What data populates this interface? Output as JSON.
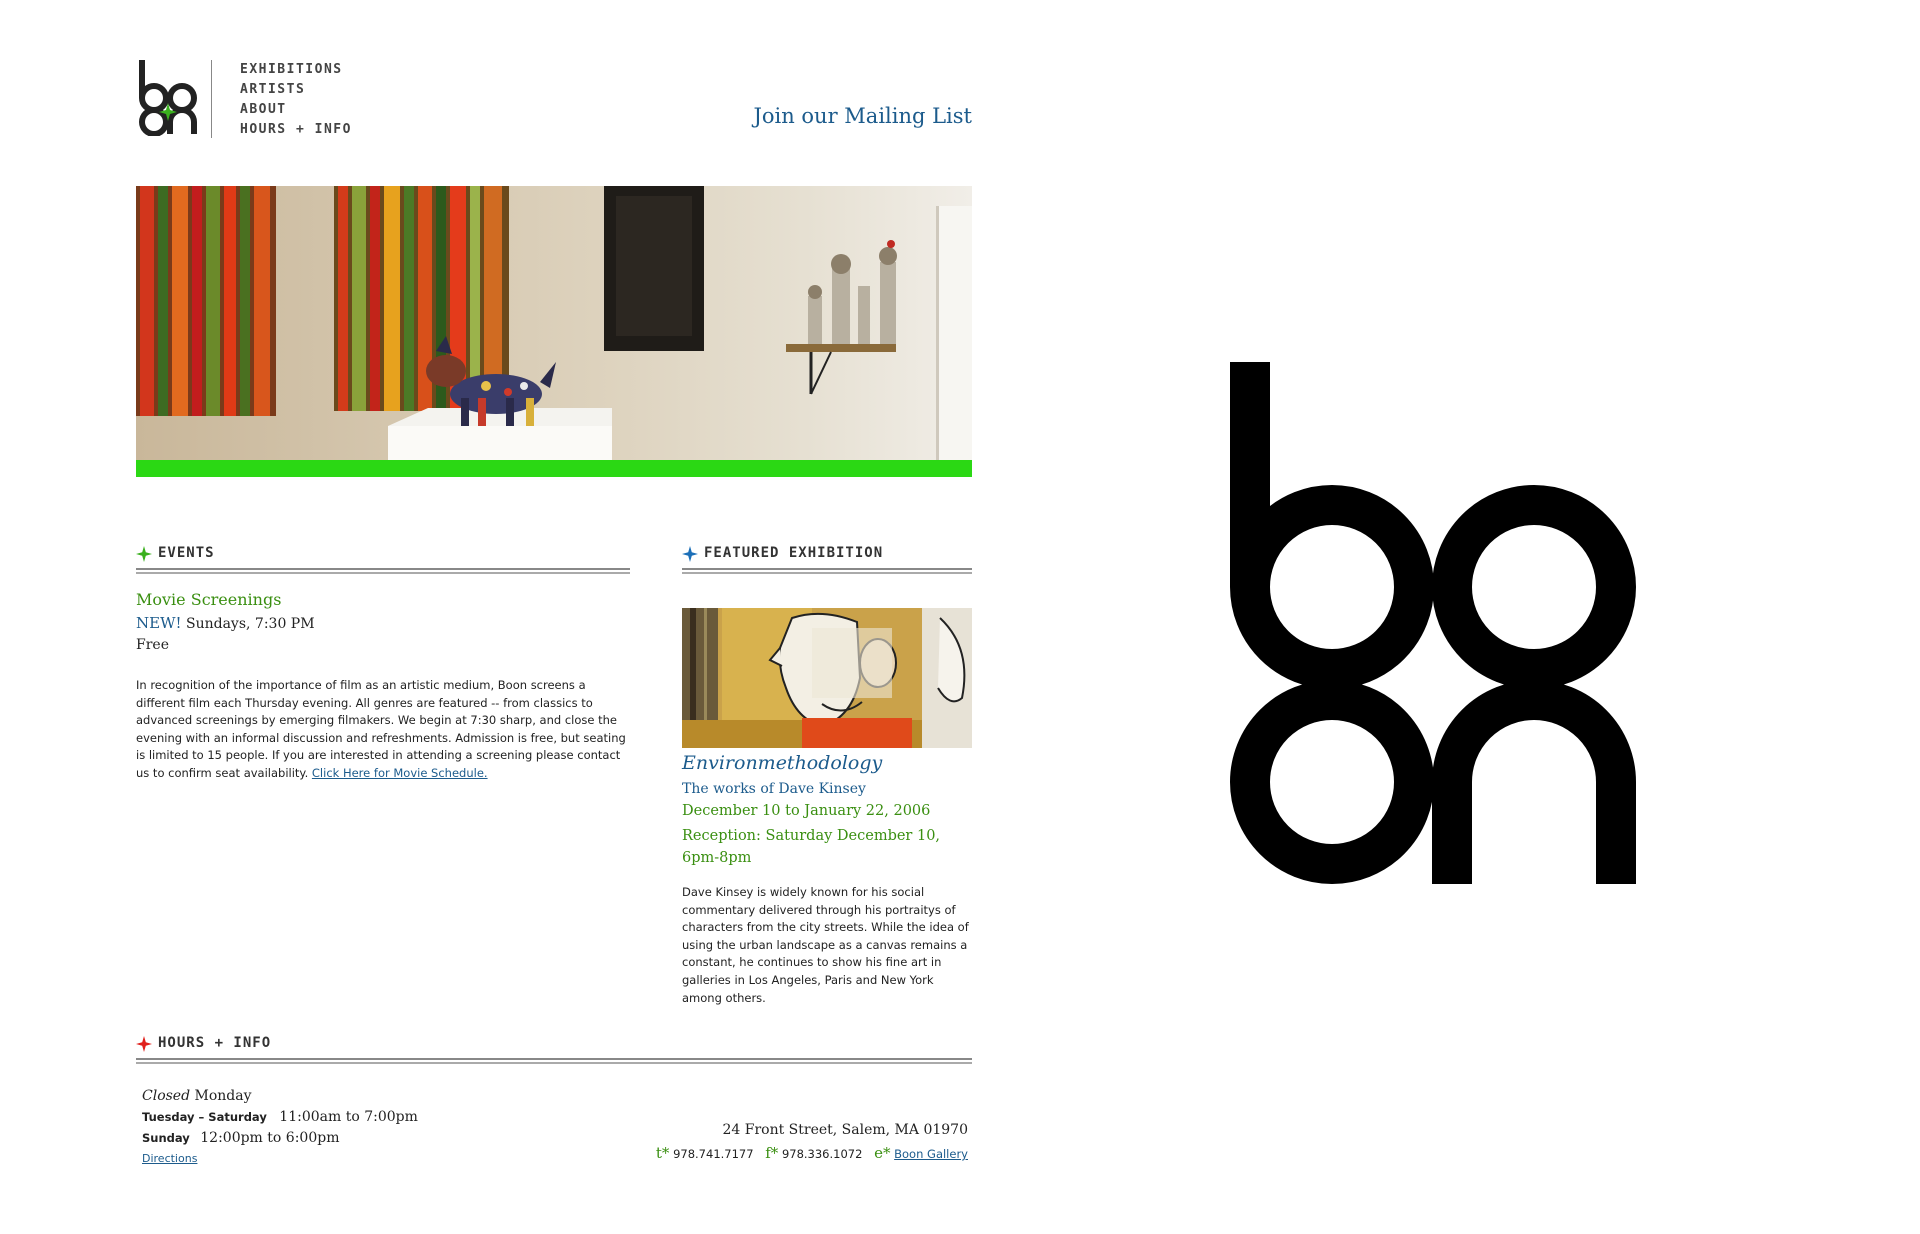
{
  "header": {
    "nav": [
      "EXHIBITIONS",
      "ARTISTS",
      "ABOUT",
      "HOURS + INFO"
    ],
    "mailing_list": "Join our Mailing List"
  },
  "events": {
    "heading": "EVENTS",
    "title": "Movie Screenings",
    "new_badge": "NEW!",
    "schedule": "Sundays, 7:30 PM",
    "price": "Free",
    "description": "In recognition of the importance of film as an artistic medium, Boon screens a different film each Thursday evening. All genres are featured -- from classics to advanced screenings by emerging filmakers. We begin at 7:30 sharp, and close the evening with an informal discussion and refreshments. Admission is free, but seating is limited to 15 people. If you are interested in attending a screening please contact us to confirm seat availability.",
    "schedule_link": "Click Here for Movie Schedule."
  },
  "featured": {
    "heading": "FEATURED EXHIBITION",
    "title": "Environmethodology",
    "subtitle": "The works of Dave Kinsey",
    "dates": "December 10 to January 22, 2006",
    "reception": "Reception: Saturday December 10, 6pm-8pm",
    "description": "Dave Kinsey is widely known for his social commentary delivered through his portraitys of characters from the city streets. While the idea of using the urban landscape as a canvas remains a constant, he continues to show his fine art in galleries in Los Angeles, Paris and New York among others."
  },
  "hours": {
    "heading": "HOURS + INFO",
    "closed_label": "Closed",
    "closed_day": "Monday",
    "row1_days": "Tuesday – Saturday",
    "row1_time": "11:00am to 7:00pm",
    "row2_days": "Sunday",
    "row2_time": "12:00pm to 6:00pm",
    "directions": "Directions",
    "address": "24 Front Street, Salem, MA 01970",
    "tel_label": "t*",
    "tel": "978.741.7177",
    "fax_label": "f*",
    "fax": "978.336.1072",
    "email_label": "e*",
    "email": "Boon Gallery"
  },
  "colors": {
    "accent_green": "#2bd814",
    "link_blue": "#1c5b8c",
    "text_green": "#3a8f11",
    "star_red": "#e0201c",
    "star_blue": "#1c6fb8"
  },
  "icons": [
    "green-star-icon",
    "blue-star-icon",
    "red-star-icon"
  ]
}
